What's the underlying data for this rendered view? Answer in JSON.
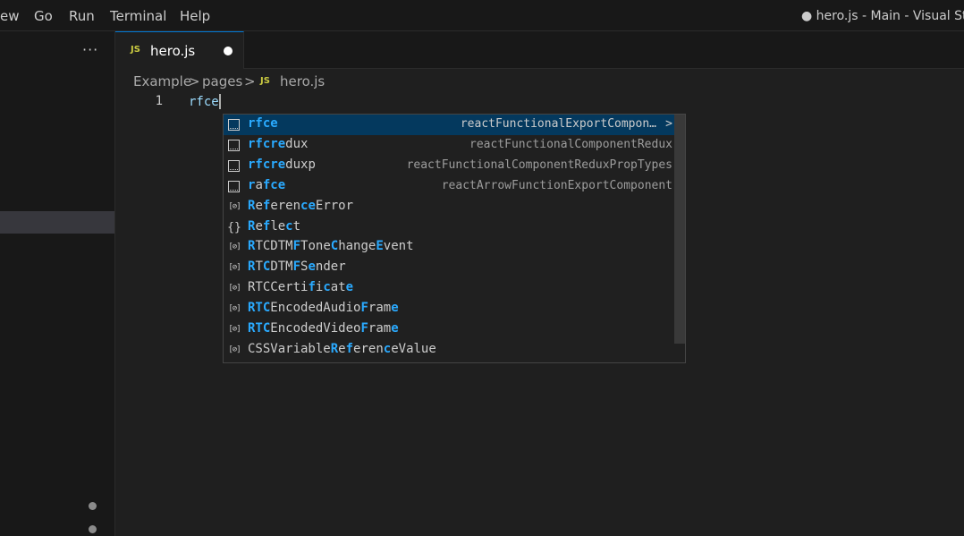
{
  "menu": [
    "ew",
    "Go",
    "Run",
    "Terminal",
    "Help"
  ],
  "window_title": "● hero.js - Main - Visual Studio",
  "sidebar": {
    "more_label": "···"
  },
  "tab": {
    "badge": "JS",
    "label": "hero.js"
  },
  "breadcrumb": {
    "items": [
      "Example",
      "pages",
      "hero.js"
    ],
    "separator": ">",
    "badge": "JS"
  },
  "editor": {
    "line_number": "1",
    "code": "rfce"
  },
  "suggestions": [
    {
      "icon": "snippet-icon",
      "segments": [
        {
          "t": "rfce",
          "m": true
        }
      ],
      "detail": "reactFunctionalExportCompon…",
      "more": ">"
    },
    {
      "icon": "snippet-icon",
      "segments": [
        {
          "t": "rfcre",
          "m": true
        },
        {
          "t": "dux",
          "m": false
        }
      ],
      "detail": "reactFunctionalComponentRedux"
    },
    {
      "icon": "snippet-icon",
      "segments": [
        {
          "t": "rfcre",
          "m": true
        },
        {
          "t": "duxp",
          "m": false
        }
      ],
      "detail": "reactFunctionalComponentReduxPropTypes"
    },
    {
      "icon": "snippet-icon",
      "segments": [
        {
          "t": "r",
          "m": true
        },
        {
          "t": "a",
          "m": false
        },
        {
          "t": "fce",
          "m": true
        }
      ],
      "detail": "reactArrowFunctionExportComponent"
    },
    {
      "icon": "variable-icon",
      "segments": [
        {
          "t": "R",
          "m": true
        },
        {
          "t": "e",
          "m": false
        },
        {
          "t": "f",
          "m": true
        },
        {
          "t": "eren",
          "m": false
        },
        {
          "t": "ce",
          "m": true
        },
        {
          "t": "Error",
          "m": false
        }
      ],
      "detail": ""
    },
    {
      "icon": "module-icon",
      "segments": [
        {
          "t": "R",
          "m": true
        },
        {
          "t": "e",
          "m": false
        },
        {
          "t": "f",
          "m": true
        },
        {
          "t": "le",
          "m": false
        },
        {
          "t": "c",
          "m": true
        },
        {
          "t": "t",
          "m": false
        }
      ],
      "detail": ""
    },
    {
      "icon": "variable-icon",
      "segments": [
        {
          "t": "R",
          "m": true
        },
        {
          "t": "TCDTM",
          "m": false
        },
        {
          "t": "F",
          "m": true
        },
        {
          "t": "Tone",
          "m": false
        },
        {
          "t": "C",
          "m": true
        },
        {
          "t": "hange",
          "m": false
        },
        {
          "t": "E",
          "m": true
        },
        {
          "t": "vent",
          "m": false
        }
      ],
      "detail": ""
    },
    {
      "icon": "variable-icon",
      "segments": [
        {
          "t": "R",
          "m": true
        },
        {
          "t": "T",
          "m": false
        },
        {
          "t": "C",
          "m": true
        },
        {
          "t": "DTM",
          "m": false
        },
        {
          "t": "F",
          "m": true
        },
        {
          "t": "S",
          "m": false
        },
        {
          "t": "e",
          "m": true
        },
        {
          "t": "nder",
          "m": false
        }
      ],
      "detail": ""
    },
    {
      "icon": "variable-icon",
      "segments": [
        {
          "t": "RTCC",
          "m": false
        },
        {
          "t": "e",
          "m": false
        },
        {
          "t": "rti",
          "m": false
        },
        {
          "t": "f",
          "m": true
        },
        {
          "t": "i",
          "m": false
        },
        {
          "t": "c",
          "m": true
        },
        {
          "t": "at",
          "m": false
        },
        {
          "t": "e",
          "m": true
        }
      ],
      "detail": ""
    },
    {
      "icon": "variable-icon",
      "segments": [
        {
          "t": "RTC",
          "m": true
        },
        {
          "t": "EncodedAudio",
          "m": false
        },
        {
          "t": "F",
          "m": true
        },
        {
          "t": "ram",
          "m": false
        },
        {
          "t": "e",
          "m": true
        }
      ],
      "detail": ""
    },
    {
      "icon": "variable-icon",
      "segments": [
        {
          "t": "RTC",
          "m": true
        },
        {
          "t": "EncodedVideo",
          "m": false
        },
        {
          "t": "F",
          "m": true
        },
        {
          "t": "ram",
          "m": false
        },
        {
          "t": "e",
          "m": true
        }
      ],
      "detail": ""
    },
    {
      "icon": "variable-icon",
      "segments": [
        {
          "t": "CSSVariable",
          "m": false
        },
        {
          "t": "R",
          "m": true
        },
        {
          "t": "e",
          "m": false
        },
        {
          "t": "f",
          "m": true
        },
        {
          "t": "eren",
          "m": false
        },
        {
          "t": "c",
          "m": true
        },
        {
          "t": "e",
          "m": false
        },
        {
          "t": "V",
          "m": false
        },
        {
          "t": "alue",
          "m": false
        }
      ],
      "detail": ""
    }
  ],
  "colors": {
    "accent": "#0078d4",
    "match": "#2aaaff",
    "selection": "#04395e",
    "js_badge": "#cbcb41"
  }
}
